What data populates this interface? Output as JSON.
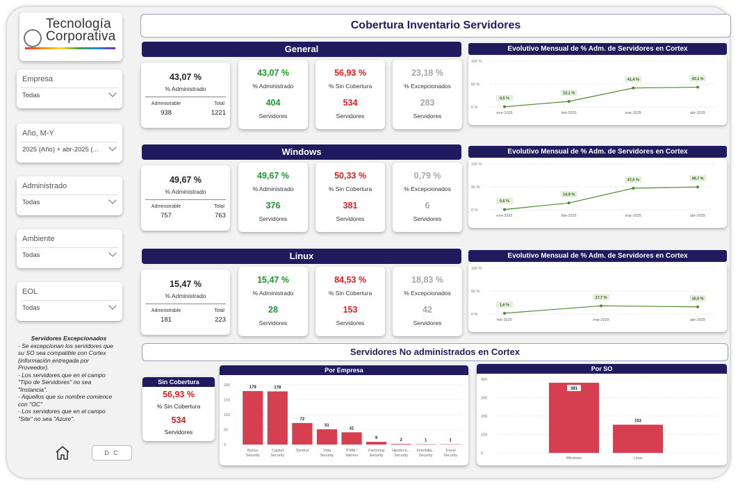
{
  "brand": {
    "line1": "Tecnología",
    "line2": "Corporativa"
  },
  "page_title": "Cobertura Inventario Servidores",
  "filters": [
    {
      "label": "Empresa",
      "value": "Todas"
    },
    {
      "label": "Año, M-Y",
      "value": "2025 (Año) + abr-2025 (..."
    },
    {
      "label": "Administrado",
      "value": "Todas"
    },
    {
      "label": "Ambiente",
      "value": "Todas"
    },
    {
      "label": "EOL",
      "value": "Todas"
    }
  ],
  "note": {
    "title": "Servidores Excepcionados",
    "lines": [
      "- Se excepcionan los servidores que su SO sea compatible con Cortex (información entregada por Proveedor).",
      "- Los servidores que en el campo \"Tipo de Servidores\" no sea \"Instancia\".",
      "- Aquellos que su nombre comience con \"OC\"",
      "- Los servidores que en el campo \"Site\" no sea \"Azure\"."
    ]
  },
  "footer": {
    "dc_label": "D C"
  },
  "labels": {
    "adm_pct": "% Administrado",
    "sin_cob": "% Sin Cobertura",
    "excep": "% Excepcionados",
    "servidores": "Servidores",
    "administrable": "Administrable",
    "total": "Total",
    "chart_title": "Evolutivo Mensual de % Adm. de Servidores en Cortex"
  },
  "sections": [
    {
      "name": "General",
      "pct": "43,07 %",
      "administrable": "938",
      "total": "1221",
      "adm_pct": "43,07 %",
      "adm_count": "404",
      "sin_pct": "56,93 %",
      "sin_count": "534",
      "exc_pct": "23,18 %",
      "exc_count": "283"
    },
    {
      "name": "Windows",
      "pct": "49,67 %",
      "administrable": "757",
      "total": "763",
      "adm_pct": "49,67 %",
      "adm_count": "376",
      "sin_pct": "50,33 %",
      "sin_count": "381",
      "exc_pct": "0,79 %",
      "exc_count": "6"
    },
    {
      "name": "Linux",
      "pct": "15,47 %",
      "administrable": "181",
      "total": "223",
      "adm_pct": "15,47 %",
      "adm_count": "28",
      "sin_pct": "84,53 %",
      "sin_count": "153",
      "exc_pct": "18,83 %",
      "exc_count": "42"
    }
  ],
  "subtitle2": "Servidores No administrados en Cortex",
  "sin_cobertura_card": {
    "title": "Sin Cobertura",
    "pct": "56,93 %",
    "pct_label": "% Sin Cobertura",
    "count": "534",
    "count_label": "Servidores"
  },
  "colors": {
    "navy": "#1f1b5e",
    "green": "#1a9a2a",
    "red": "#e01e1e",
    "gray": "#a8a8a8",
    "bar": "#d63f4f",
    "line": "#4e8a2c"
  },
  "chart_data": [
    {
      "type": "line",
      "title": "Evolutivo Mensual de % Adm. de Servidores en Cortex",
      "x": [
        "ene-2025",
        "feb-2025",
        "mar-2025",
        "abr-2025"
      ],
      "values": [
        0.5,
        12.1,
        41.4,
        43.1
      ],
      "labels": [
        "0,5 %",
        "12,1 %",
        "41,4 %",
        "43,1 %"
      ],
      "yticks": [
        "100 %",
        "50 %",
        "0 %"
      ],
      "ylim": [
        0,
        100
      ]
    },
    {
      "type": "line",
      "title": "Evolutivo Mensual de % Adm. de Servidores en Cortex",
      "x": [
        "ene-2025",
        "feb-2025",
        "mar-2025",
        "abr-2025"
      ],
      "values": [
        0.6,
        14.9,
        47.0,
        49.7
      ],
      "labels": [
        "0,6 %",
        "14,9 %",
        "47,0 %",
        "49,7 %"
      ],
      "yticks": [
        "100 %",
        "50 %",
        "0 %"
      ],
      "ylim": [
        0,
        100
      ]
    },
    {
      "type": "line",
      "title": "Evolutivo Mensual de % Adm. de Servidores en Cortex",
      "x": [
        "feb-2025",
        "mar-2025",
        "abr-2025"
      ],
      "values": [
        1.6,
        17.7,
        15.5
      ],
      "labels": [
        "1,6 %",
        "17,7 %",
        "15,5 %"
      ],
      "yticks": [
        "100 %",
        "50 %",
        "0 %"
      ],
      "ylim": [
        0,
        100
      ]
    },
    {
      "type": "bar",
      "title": "Por Empresa",
      "categories": [
        "Banco Security",
        "Capital Security",
        "Syndryl",
        "Vida Security",
        "ITMM / Valores",
        "Factoring Security",
        "Hipoteca... Security",
        "Inmobilia... Security",
        "Travel Security"
      ],
      "values": [
        179,
        178,
        72,
        51,
        41,
        9,
        2,
        1,
        1
      ],
      "yticks": [
        200,
        150,
        100,
        50,
        0
      ],
      "ylim": [
        0,
        200
      ]
    },
    {
      "type": "bar",
      "title": "Por SO",
      "categories": [
        "Windows",
        "Linux"
      ],
      "values": [
        381,
        153
      ],
      "yticks": [
        400,
        300,
        200,
        100,
        0
      ],
      "ylim": [
        0,
        400
      ]
    }
  ]
}
